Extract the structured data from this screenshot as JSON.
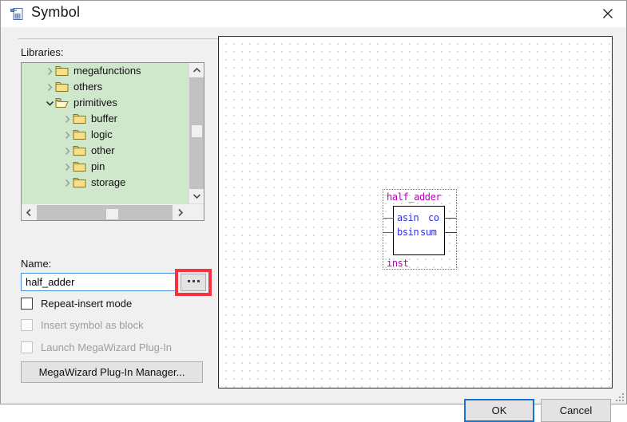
{
  "window": {
    "title": "Symbol",
    "icon": "symbol-document-icon",
    "close_label": "✕"
  },
  "left_panel": {
    "libraries_label": "Libraries:",
    "tree": [
      {
        "label": "megafunctions",
        "level": 0,
        "expanded": false,
        "arrow": "chevron-right",
        "folder": "folder-closed"
      },
      {
        "label": "others",
        "level": 0,
        "expanded": false,
        "arrow": "chevron-right",
        "folder": "folder-closed"
      },
      {
        "label": "primitives",
        "level": 0,
        "expanded": true,
        "arrow": "chevron-down",
        "folder": "folder-open"
      },
      {
        "label": "buffer",
        "level": 1,
        "expanded": false,
        "arrow": "chevron-right",
        "folder": "folder-closed"
      },
      {
        "label": "logic",
        "level": 1,
        "expanded": false,
        "arrow": "chevron-right",
        "folder": "folder-closed"
      },
      {
        "label": "other",
        "level": 1,
        "expanded": false,
        "arrow": "chevron-right",
        "folder": "folder-closed"
      },
      {
        "label": "pin",
        "level": 1,
        "expanded": false,
        "arrow": "chevron-right",
        "folder": "folder-closed"
      },
      {
        "label": "storage",
        "level": 1,
        "expanded": false,
        "arrow": "chevron-right",
        "folder": "folder-closed"
      }
    ],
    "tree_background": "#cfe7cb",
    "name_label": "Name:",
    "name_value": "half_adder",
    "name_placeholder": "",
    "browse_label": "...",
    "browse_highlight_color": "#f5333f",
    "checkboxes": [
      {
        "label": "Repeat-insert mode",
        "checked": false,
        "enabled": true
      },
      {
        "label": "Insert symbol as block",
        "checked": false,
        "enabled": false
      },
      {
        "label": "Launch MegaWizard Plug-In",
        "checked": false,
        "enabled": false
      }
    ],
    "megawizard_label": "MegaWizard Plug-In Manager..."
  },
  "canvas": {
    "symbol": {
      "title": "half_adder",
      "instance": "inst",
      "title_color": "#b500b5",
      "port_color": "#2f2fe0",
      "selection_color": "#0e9f9f",
      "inputs": [
        {
          "name": "asin"
        },
        {
          "name": "bsin"
        }
      ],
      "outputs": [
        {
          "name": "co"
        },
        {
          "name": "sum"
        }
      ]
    }
  },
  "footer": {
    "ok_label": "OK",
    "cancel_label": "Cancel",
    "accent_color": "#1675d1"
  }
}
